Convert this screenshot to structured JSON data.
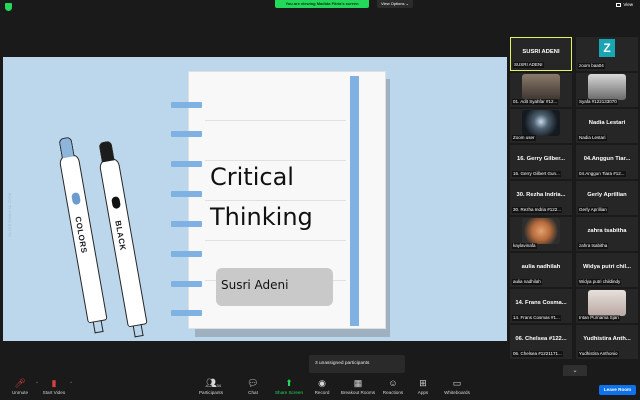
{
  "topbar": {
    "viewing_banner": "You are viewing Madida Fitria's screen",
    "view_options": "View Options ⌄",
    "view_label": "View"
  },
  "slide": {
    "title_line1": "Critical",
    "title_line2": "Thinking",
    "author": "Susri Adeni",
    "watermark": "SLIDESMANIA.COM",
    "marker_left_label": "COLORS",
    "marker_right_label": "BLACK"
  },
  "gallery": {
    "tiles": [
      {
        "big": "SUSRI ADENI",
        "name": "SUSRI ADENI"
      },
      {
        "avatar_letter": "Z",
        "name": "zoom baa04"
      },
      {
        "name": "01. Adit Syahfar #12..."
      },
      {
        "name": "Syafa #122133070"
      },
      {
        "name": "Zoom user"
      },
      {
        "big": "Nadia Lestari",
        "name": "Nadia Lestari"
      },
      {
        "big": "16. Gerry Gilber...",
        "name": "16. Gerry Gilbert Gun..."
      },
      {
        "big": "04.Anggun Tiar...",
        "name": "04.Anggun Tiara #12..."
      },
      {
        "big": "30. Rezha Indria...",
        "name": "30. Rezha Indria #122..."
      },
      {
        "big": "Gerly Aprillian",
        "name": "Gerly Aprillian"
      },
      {
        "name": "kaylavinafa"
      },
      {
        "big": "zahra tsabitha",
        "name": "zahra tsabitha"
      },
      {
        "big": "aulia nadhilah",
        "name": "aulia nadhilah"
      },
      {
        "big": "Widya putri chil...",
        "name": "Widya putri childindy"
      },
      {
        "big": "14. Frans Cosma...",
        "name": "14. Frans Cosmas #1..."
      },
      {
        "name": "Intan Purnama Sjari"
      },
      {
        "big": "06. Chelsea #122...",
        "name": "06. Chelsea #1221171..."
      },
      {
        "big": "Yudhistira Anth...",
        "name": "Yudhistira Anthonio"
      }
    ]
  },
  "popup": {
    "text": "3 unassigned participants"
  },
  "toolbar": {
    "unmute": "Unmute",
    "start_video": "Start Video",
    "participants": "Participants",
    "participants_count": "34",
    "chat": "Chat",
    "share_screen": "Share Screen",
    "record": "Record",
    "breakout_rooms": "Breakout Rooms",
    "reactions": "Reactions",
    "apps": "Apps",
    "whiteboards": "Whiteboards",
    "leave": "Leave Room"
  }
}
